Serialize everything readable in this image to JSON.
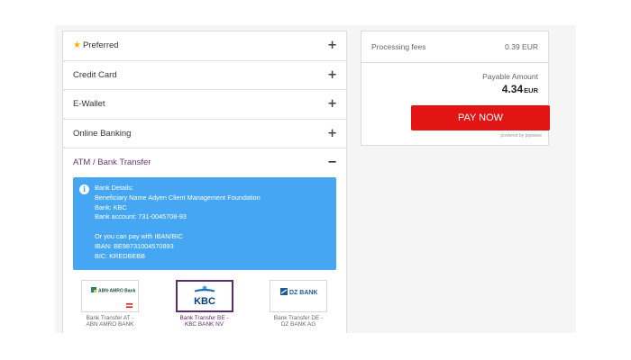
{
  "accordion": {
    "items": [
      {
        "label": "Preferred",
        "sign": "+"
      },
      {
        "label": "Credit Card",
        "sign": "+"
      },
      {
        "label": "E-Wallet",
        "sign": "+"
      },
      {
        "label": "Online Banking",
        "sign": "+"
      },
      {
        "label": "ATM / Bank Transfer",
        "sign": "−"
      }
    ]
  },
  "bank_details": {
    "lines": [
      "Bank Details:",
      "Beneficiary Name Adyen Client Management Foundation",
      "Bank: KBC",
      "Bank account: 731-0045708-93",
      "",
      "Or you can pay with IBAN/BIC",
      "IBAN: BE98731004570893",
      "BIC: KREDBEBB"
    ]
  },
  "banks": [
    {
      "logo": "ABN·AMRO Bank",
      "name_line1": "Bank Transfer AT -",
      "name_line2": "ABN AMRO BANK"
    },
    {
      "logo": "KBC",
      "name_line1": "Bank Transfer BE -",
      "name_line2": "KBC BANK NV"
    },
    {
      "logo": "DZ BANK",
      "name_line1": "Bank Transfer DE -",
      "name_line2": "DZ BANK AG"
    }
  ],
  "summary": {
    "fees_label": "Processing fees",
    "fees_value": "0.39 EUR",
    "payable_label": "Payable Amount",
    "amount": "4.34",
    "currency": "EUR",
    "pay_button": "PAY NOW",
    "powered_by": "powered by pipwave"
  },
  "colors": {
    "accent": "#6b3478",
    "info_bg": "#45a7f4",
    "pay_button": "#e21414",
    "star": "#f5b400"
  }
}
